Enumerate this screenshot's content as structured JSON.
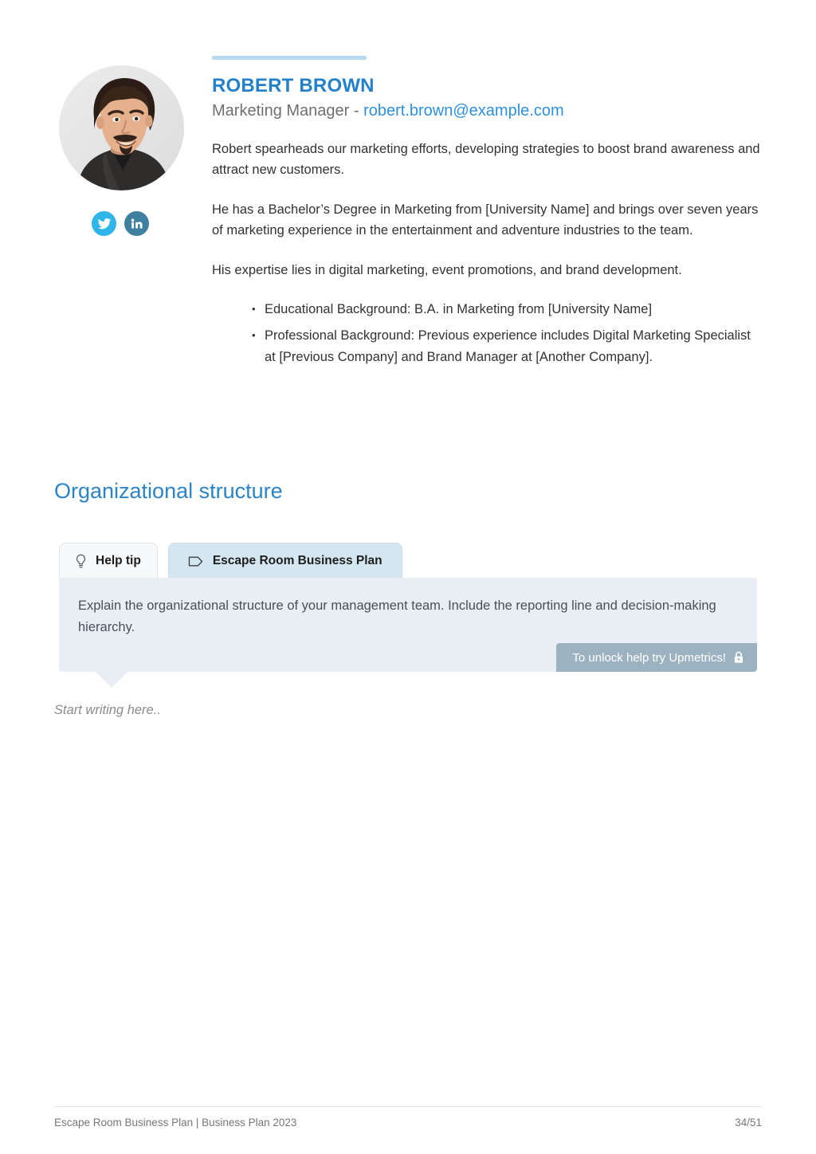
{
  "profile": {
    "name": "ROBERT BROWN",
    "role": "Marketing Manager",
    "separator": " - ",
    "email": "robert.brown@example.com",
    "paragraphs": [
      "Robert spearheads our marketing efforts, developing strategies to boost brand awareness and attract new customers.",
      "He has a Bachelor’s Degree in Marketing from [University Name] and brings over seven years of marketing experience in the entertainment and adventure industries to the team.",
      "His expertise lies in digital marketing, event promotions, and brand development."
    ],
    "bullets": [
      "Educational Background: B.A. in Marketing from [University Name]",
      "Professional Background: Previous experience includes Digital Marketing Specialist at [Previous Company] and Brand Manager at [Another Company]."
    ],
    "socials": [
      {
        "name": "twitter",
        "label": "Twitter",
        "color": "#2fb5e8"
      },
      {
        "name": "linkedin",
        "label": "LinkedIn",
        "color": "#3f7fa0"
      }
    ],
    "accent_color": "#b8daf0",
    "name_color": "#2481c9",
    "email_color": "#2e8fdc"
  },
  "section": {
    "title": "Organizational structure",
    "title_color": "#2b83c8"
  },
  "tabs": [
    {
      "label": "Help tip",
      "icon": "lightbulb-icon",
      "active": false
    },
    {
      "label": "Escape Room Business Plan",
      "icon": "tag-icon",
      "active": true
    }
  ],
  "help_tip": {
    "text": "Explain the organizational structure of your management team. Include the reporting line and decision-making hierarchy.",
    "unlock_label": "To unlock help try Upmetrics!",
    "unlock_icon": "lock-icon",
    "background": "#e9edf4",
    "badge_color": "#9db2c0"
  },
  "editor": {
    "placeholder": "Start writing here.."
  },
  "footer": {
    "left": "Escape Room Business Plan | Business Plan 2023",
    "page": "34/51"
  }
}
